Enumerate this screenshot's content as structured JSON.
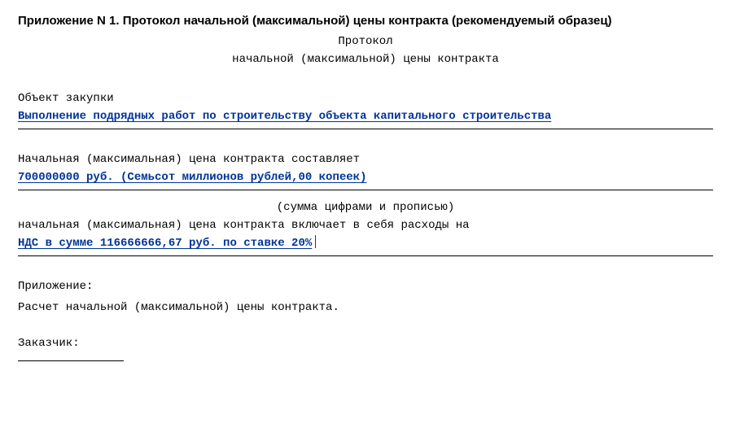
{
  "heading": "Приложение N 1. Протокол начальной (максимальной) цены контракта (рекомендуемый образец)",
  "title_line1": "Протокол",
  "title_line2": "начальной (максимальной) цены контракта",
  "section_object_label": "Объект закупки",
  "object_value": "Выполнение подрядных работ по строительству объекта капитального строительства",
  "price_intro": "Начальная (максимальная) цена контракта составляет",
  "price_value": "700000000 руб. (Семьсот миллионов рублей,00 копеек)",
  "sum_hint": "(сумма цифрами и прописью)",
  "includes_intro": "начальная (максимальная) цена контракта включает в себя расходы на",
  "vat_value": "НДС в сумме 116666666,67 руб. по ставке 20%",
  "attachment_label": "Приложение:",
  "attachment_text": "Расчет начальной (максимальной) цены контракта.",
  "customer_label": "Заказчик:"
}
